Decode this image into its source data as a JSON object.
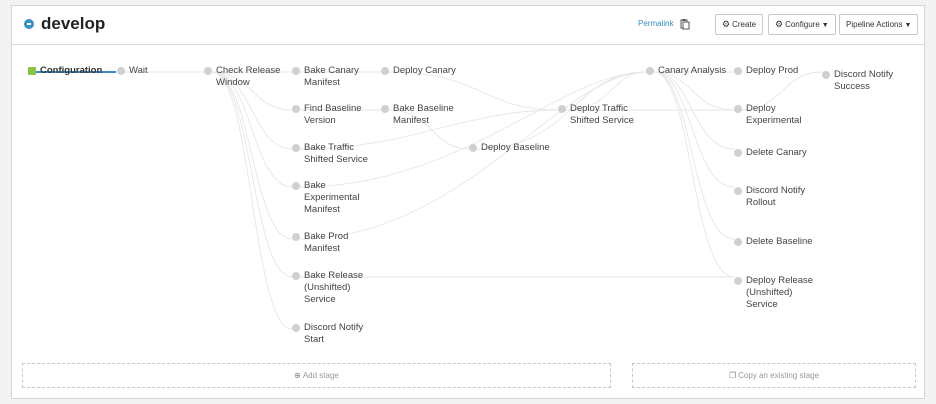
{
  "header": {
    "title": "develop",
    "permalink_label": "Permalink",
    "create_label": "Create",
    "configure_label": "Configure",
    "pipeline_actions_label": "Pipeline Actions"
  },
  "stages": {
    "configuration": "Configuration",
    "wait": "Wait",
    "check_release_window": "Check Release\nWindow",
    "bake_canary_manifest": "Bake Canary\nManifest",
    "find_baseline_version": "Find Baseline\nVersion",
    "bake_traffic_shifted_service": "Bake Traffic\nShifted Service",
    "bake_experimental_manifest": "Bake\nExperimental\nManifest",
    "bake_prod_manifest": "Bake Prod\nManifest",
    "bake_release_unshifted_service": "Bake Release\n(Unshifted)\nService",
    "discord_notify_start": "Discord Notify\nStart",
    "deploy_canary": "Deploy Canary",
    "bake_baseline_manifest": "Bake Baseline\nManifest",
    "deploy_baseline": "Deploy Baseline",
    "deploy_traffic_shifted_service": "Deploy Traffic\nShifted Service",
    "canary_analysis": "Canary Analysis",
    "deploy_prod": "Deploy Prod",
    "deploy_experimental": "Deploy\nExperimental",
    "delete_canary": "Delete Canary",
    "discord_notify_rollout": "Discord Notify\nRollout",
    "delete_baseline": "Delete Baseline",
    "deploy_release_unshifted_service": "Deploy Release\n(Unshifted)\nService",
    "discord_notify_success": "Discord Notify\nSuccess"
  },
  "footer": {
    "add_stage_label": "Add stage",
    "copy_stage_label": "Copy an existing stage"
  },
  "colors": {
    "accent": "#3a8fc4",
    "active_stage": "#8bc34a",
    "stage_dot": "#d0d0d0"
  }
}
